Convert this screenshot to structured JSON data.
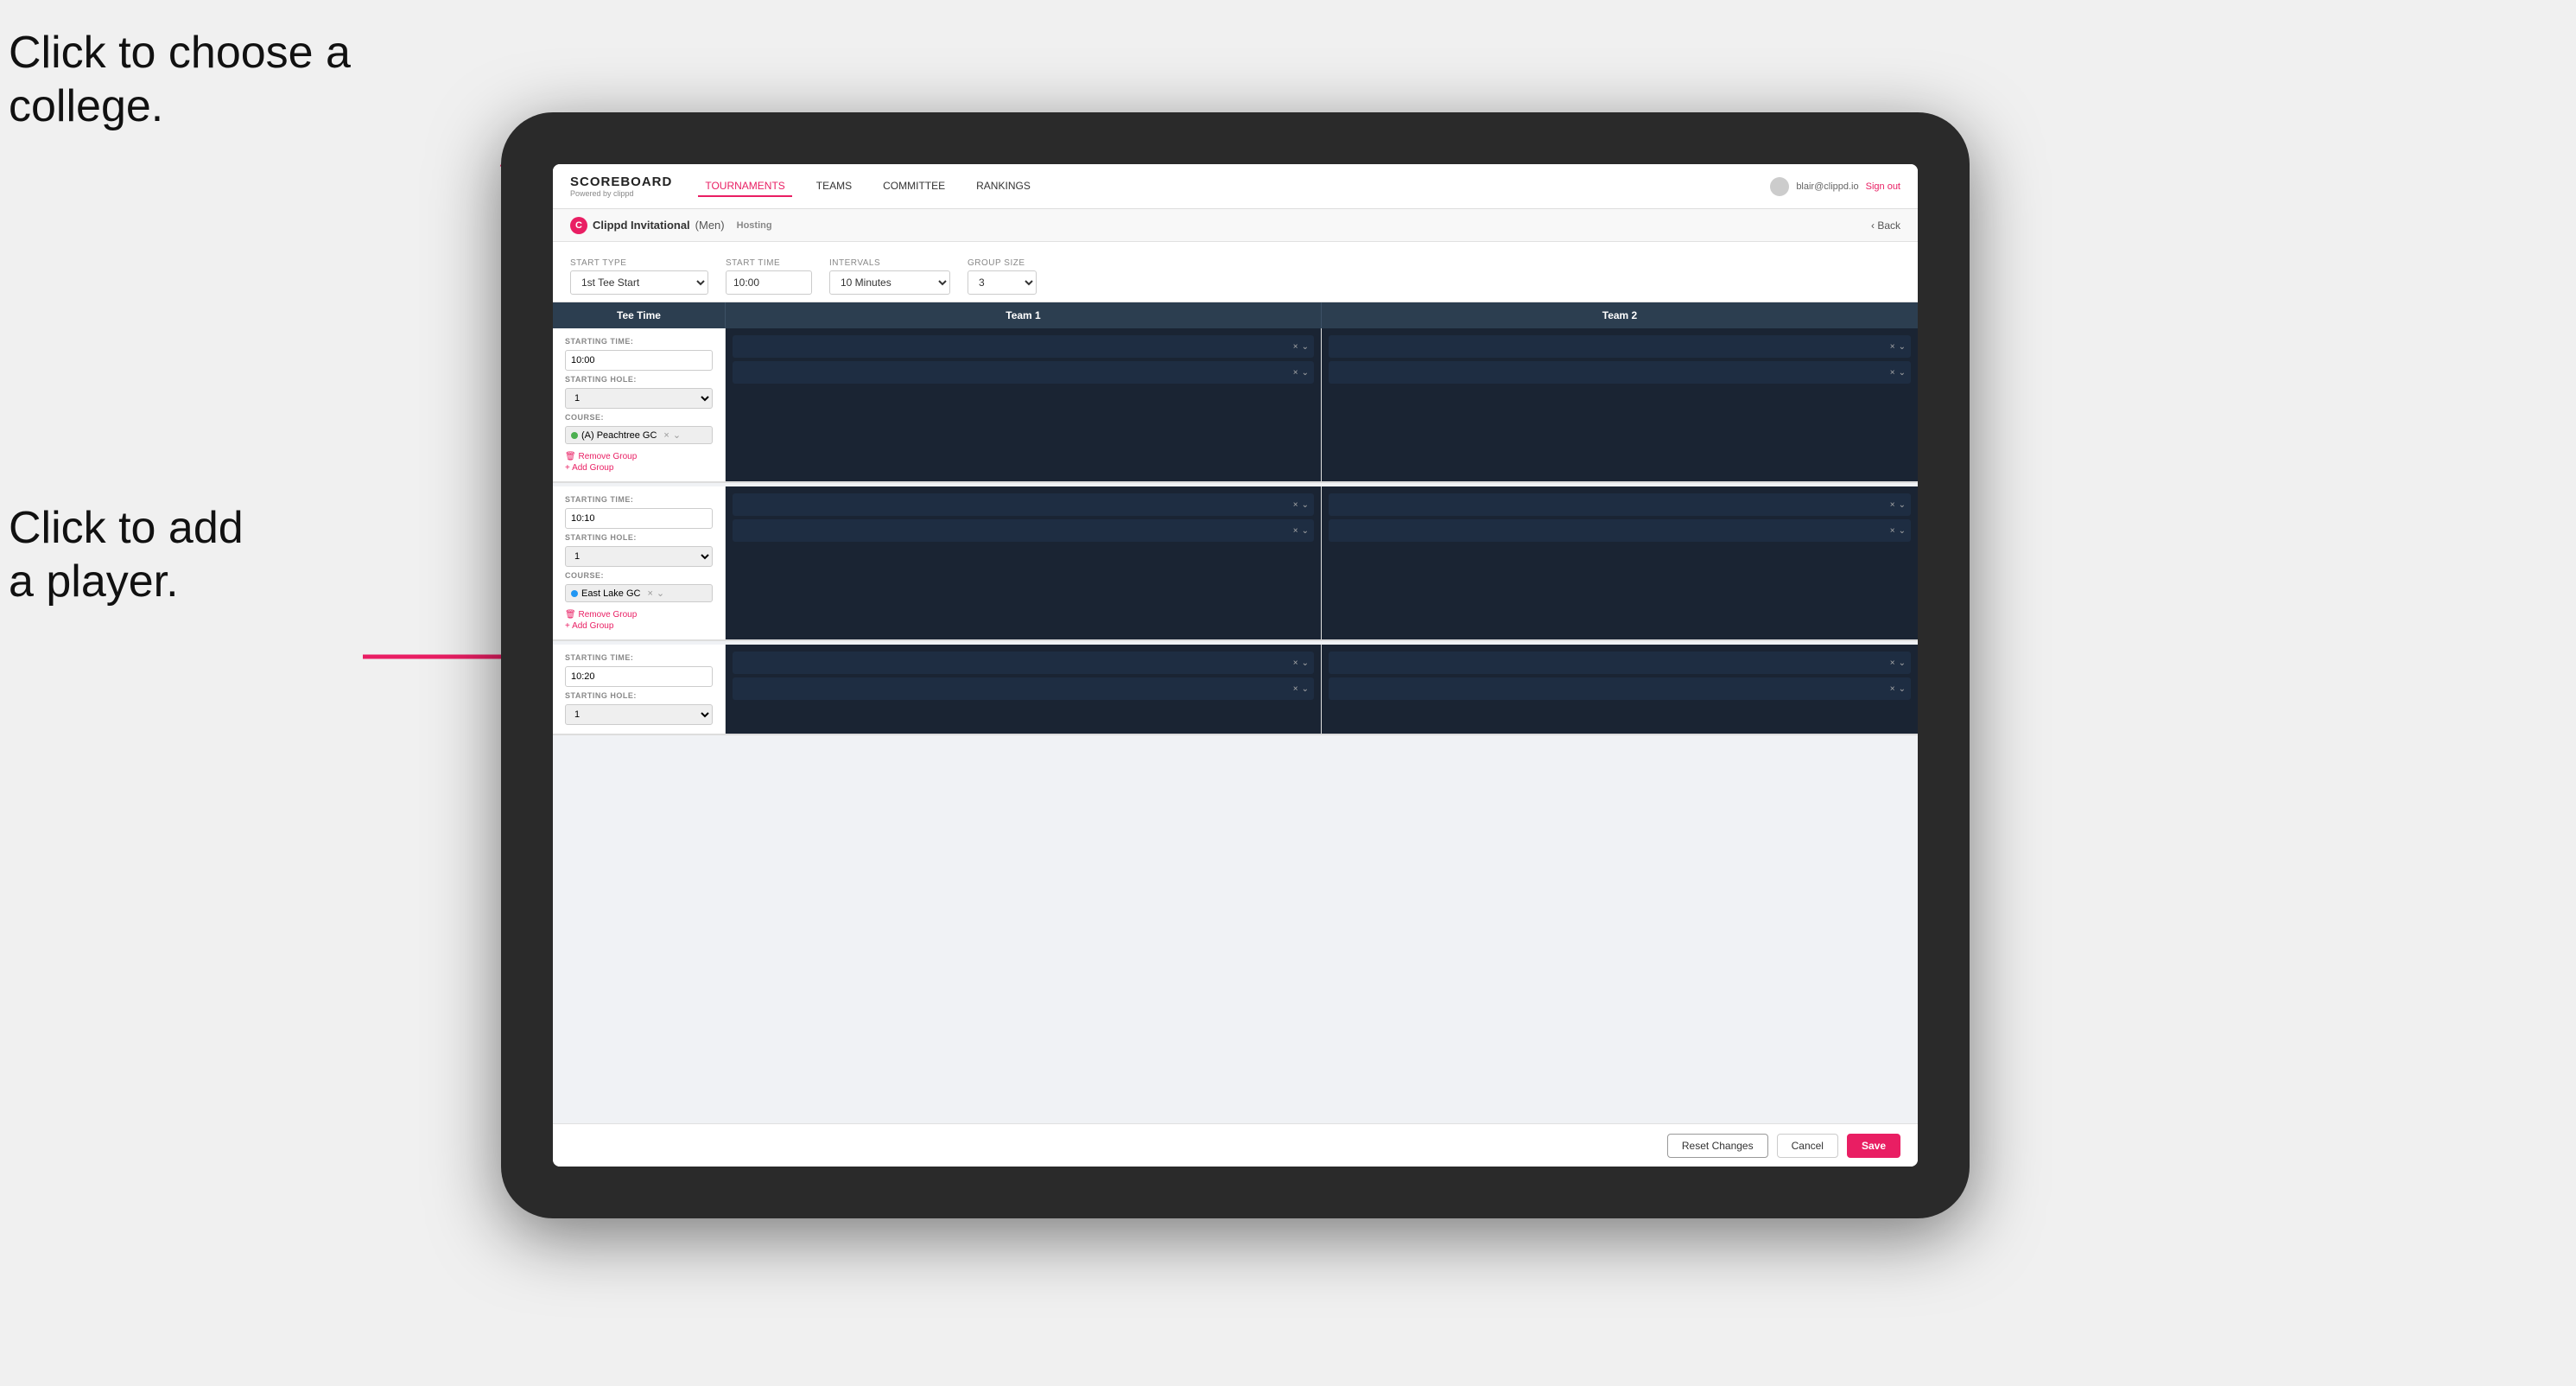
{
  "annotations": {
    "text1_line1": "Click to choose a",
    "text1_line2": "college.",
    "text2_line1": "Click to add",
    "text2_line2": "a player."
  },
  "navbar": {
    "brand": "SCOREBOARD",
    "powered_by": "Powered by clippd",
    "links": [
      "TOURNAMENTS",
      "TEAMS",
      "COMMITTEE",
      "RANKINGS"
    ],
    "active_link": "TOURNAMENTS",
    "user_email": "blair@clippd.io",
    "sign_out": "Sign out"
  },
  "sub_header": {
    "event_name": "Clippd Invitational",
    "gender": "(Men)",
    "status": "Hosting",
    "back_label": "Back"
  },
  "settings": {
    "start_type_label": "Start Type",
    "start_type_value": "1st Tee Start",
    "start_time_label": "Start Time",
    "start_time_value": "10:00",
    "intervals_label": "Intervals",
    "intervals_value": "10 Minutes",
    "group_size_label": "Group Size",
    "group_size_value": "3"
  },
  "table": {
    "col1": "Tee Time",
    "col2": "Team 1",
    "col3": "Team 2"
  },
  "groups": [
    {
      "starting_time": "10:00",
      "starting_hole": "1",
      "course": "(A) Peachtree GC",
      "course_type": "A",
      "team1_players": 2,
      "team2_players": 2,
      "has_course": true
    },
    {
      "starting_time": "10:10",
      "starting_hole": "1",
      "course": "East Lake GC",
      "course_type": "B",
      "team1_players": 2,
      "team2_players": 2,
      "has_course": true
    },
    {
      "starting_time": "10:20",
      "starting_hole": "1",
      "course": "",
      "course_type": "",
      "team1_players": 2,
      "team2_players": 2,
      "has_course": false
    }
  ],
  "footer": {
    "reset_label": "Reset Changes",
    "cancel_label": "Cancel",
    "save_label": "Save"
  }
}
